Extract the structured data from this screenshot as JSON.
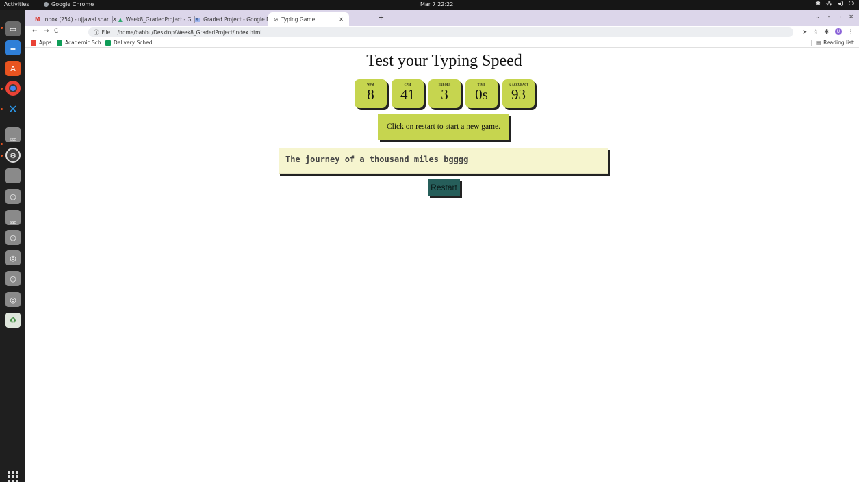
{
  "system_bar": {
    "activities": "Activities",
    "app_name": "Google Chrome",
    "clock": "Mar 7  22:22"
  },
  "dock": {
    "items": [
      "files-icon",
      "text-editor-icon",
      "software-store-icon",
      "chrome-icon",
      "vscode-icon",
      "ssd-drive-icon",
      "settings-icon",
      "drive-icon",
      "disc-icon",
      "ssd-drive-icon",
      "disc-icon",
      "disc-icon",
      "disc-icon",
      "disc-icon",
      "trash-icon"
    ]
  },
  "browser": {
    "tabs": [
      {
        "label": "Inbox (254) - ujjawal.shar",
        "icon": "gmail-icon"
      },
      {
        "label": "Week8_GradedProject - G",
        "icon": "drive-icon"
      },
      {
        "label": "Graded Project - Google D",
        "icon": "docs-icon"
      },
      {
        "label": "Typing Game",
        "icon": "globe-icon"
      }
    ],
    "new_tab": "+",
    "url_scheme": "File",
    "url": "/home/babbu/Desktop/Week8_GradedProject/index.html",
    "bookmarks": [
      {
        "label": "Apps",
        "color": "#e94235"
      },
      {
        "label": "Academic Sch...",
        "color": "#0f9d58"
      },
      {
        "label": "Delivery Sched...",
        "color": "#0f9d58"
      }
    ],
    "reading_list": "Reading list"
  },
  "page": {
    "title": "Test your Typing Speed",
    "stats": [
      {
        "label": "WPM",
        "value": "8"
      },
      {
        "label": "CPM",
        "value": "41"
      },
      {
        "label": "ERRORS",
        "value": "3"
      },
      {
        "label": "TIME",
        "value": "0s"
      },
      {
        "label": "% ACCURACY",
        "value": "93"
      }
    ],
    "message": "Click on restart to start a new game.",
    "typed_text": "The journey of a thousand miles bgggg",
    "restart_label": "Restart"
  },
  "colors": {
    "stat_bg": "#c6d54f",
    "typing_bg": "#f6f5cf",
    "restart_bg": "#265e5a"
  }
}
